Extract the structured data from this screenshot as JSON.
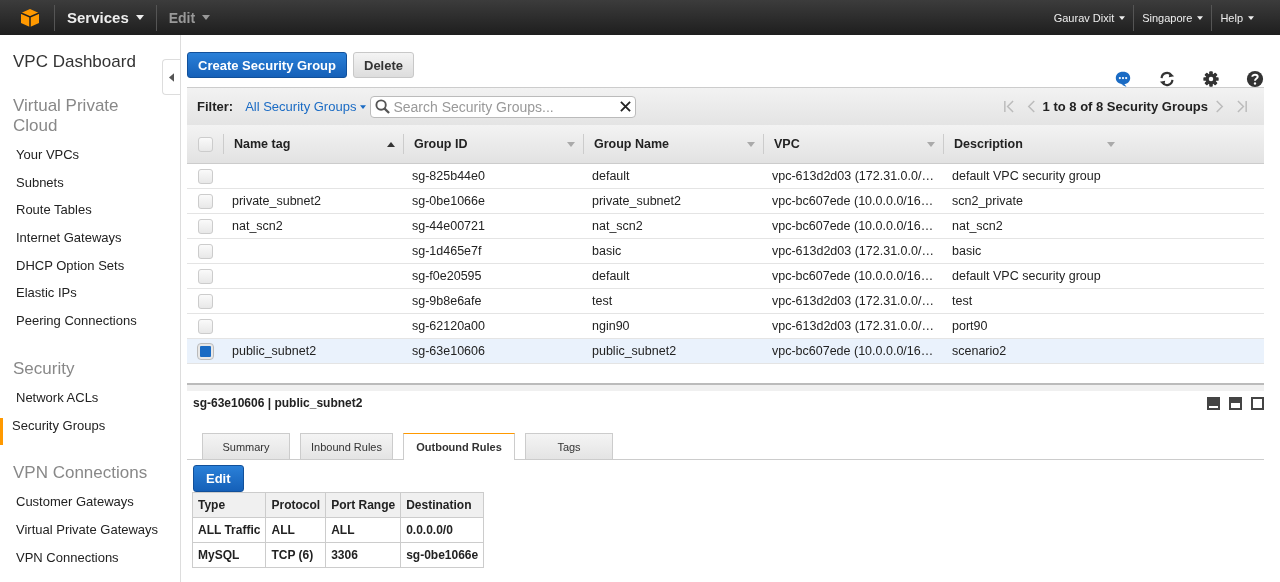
{
  "top_nav": {
    "services": "Services",
    "edit": "Edit",
    "user": "Gaurav Dixit",
    "region": "Singapore",
    "help": "Help"
  },
  "sidebar": {
    "title": "VPC Dashboard",
    "sections": [
      {
        "heading": "Virtual Private Cloud",
        "items": [
          {
            "label": "Your VPCs",
            "selected": false
          },
          {
            "label": "Subnets",
            "selected": false
          },
          {
            "label": "Route Tables",
            "selected": false
          },
          {
            "label": "Internet Gateways",
            "selected": false
          },
          {
            "label": "DHCP Option Sets",
            "selected": false
          },
          {
            "label": "Elastic IPs",
            "selected": false
          },
          {
            "label": "Peering Connections",
            "selected": false
          }
        ]
      },
      {
        "heading": "Security",
        "items": [
          {
            "label": "Network ACLs",
            "selected": false
          },
          {
            "label": "Security Groups",
            "selected": true
          }
        ]
      },
      {
        "heading": "VPN Connections",
        "items": [
          {
            "label": "Customer Gateways",
            "selected": false
          },
          {
            "label": "Virtual Private Gateways",
            "selected": false
          },
          {
            "label": "VPN Connections",
            "selected": false
          }
        ]
      }
    ]
  },
  "toolbar": {
    "buttons": [
      {
        "label": "Create Security Group",
        "kind": "primary"
      },
      {
        "label": "Delete",
        "kind": "secondary"
      }
    ]
  },
  "filter": {
    "label": "Filter:",
    "dropdown": "All Security Groups",
    "placeholder": "Search Security Groups...",
    "pagination": "1 to 8 of 8 Security Groups"
  },
  "table": {
    "all_checked": false,
    "columns": [
      {
        "label": "Name tag",
        "sorted": true
      },
      {
        "label": "Group ID",
        "sorted": false
      },
      {
        "label": "Group Name",
        "sorted": false
      },
      {
        "label": "VPC",
        "sorted": false
      },
      {
        "label": "Description",
        "sorted": false
      }
    ],
    "rows": [
      {
        "selected": false,
        "cells": [
          "",
          "sg-825b44e0",
          "default",
          "vpc-613d2d03 (172.31.0.0/…",
          "default VPC security group"
        ]
      },
      {
        "selected": false,
        "cells": [
          "private_subnet2",
          "sg-0be1066e",
          "private_subnet2",
          "vpc-bc607ede (10.0.0.0/16…",
          "scn2_private"
        ]
      },
      {
        "selected": false,
        "cells": [
          "nat_scn2",
          "sg-44e00721",
          "nat_scn2",
          "vpc-bc607ede (10.0.0.0/16…",
          "nat_scn2"
        ]
      },
      {
        "selected": false,
        "cells": [
          "",
          "sg-1d465e7f",
          "basic",
          "vpc-613d2d03 (172.31.0.0/…",
          "basic"
        ]
      },
      {
        "selected": false,
        "cells": [
          "",
          "sg-f0e20595",
          "default",
          "vpc-bc607ede (10.0.0.0/16…",
          "default VPC security group"
        ]
      },
      {
        "selected": false,
        "cells": [
          "",
          "sg-9b8e6afe",
          "test",
          "vpc-613d2d03 (172.31.0.0/…",
          "test"
        ]
      },
      {
        "selected": false,
        "cells": [
          "",
          "sg-62120a00",
          "ngin90",
          "vpc-613d2d03 (172.31.0.0/…",
          "port90"
        ]
      },
      {
        "selected": true,
        "cells": [
          "public_subnet2",
          "sg-63e10606",
          "public_subnet2",
          "vpc-bc607ede (10.0.0.0/16…",
          "scenario2"
        ]
      }
    ]
  },
  "details": {
    "title": "sg-63e10606 | public_subnet2",
    "tabs": [
      {
        "label": "Summary",
        "selected": false
      },
      {
        "label": "Inbound Rules",
        "selected": false
      },
      {
        "label": "Outbound Rules",
        "selected": true
      },
      {
        "label": "Tags",
        "selected": false
      }
    ],
    "edit_button": "Edit",
    "rules": {
      "columns": [
        "Type",
        "Protocol",
        "Port Range",
        "Destination"
      ],
      "rows": [
        [
          "ALL Traffic",
          "ALL",
          "ALL",
          "0.0.0.0/0"
        ],
        [
          "MySQL",
          "TCP (6)",
          "3306",
          "sg-0be1066e"
        ]
      ]
    }
  }
}
